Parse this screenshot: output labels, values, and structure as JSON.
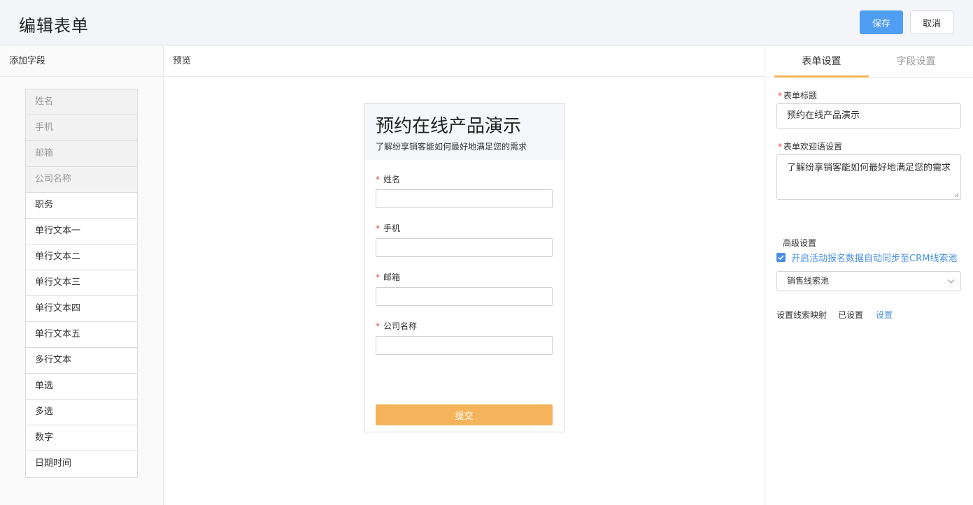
{
  "header": {
    "title": "编辑表单",
    "save_label": "保存",
    "cancel_label": "取消"
  },
  "left_panel": {
    "title": "添加字段",
    "used_fields": [
      "姓名",
      "手机",
      "邮箱",
      "公司名称"
    ],
    "fields": [
      "职务",
      "单行文本一",
      "单行文本二",
      "单行文本三",
      "单行文本四",
      "单行文本五",
      "多行文本",
      "单选",
      "多选",
      "数字",
      "日期时间"
    ]
  },
  "preview": {
    "title": "预览",
    "form_title": "预约在线产品演示",
    "form_subtitle": "了解纷享销客能如何最好地满足您的需求",
    "fields": [
      {
        "required_mark": "*",
        "label": "姓名"
      },
      {
        "required_mark": "*",
        "label": "手机"
      },
      {
        "required_mark": "*",
        "label": "邮箱"
      },
      {
        "required_mark": "*",
        "label": "公司名称"
      }
    ],
    "submit_label": "提交"
  },
  "settings": {
    "tabs": [
      "表单设置",
      "字段设置"
    ],
    "active_tab": "表单设置",
    "required_mark": "*",
    "form_title_label": "表单标题",
    "form_title_value": "预约在线产品演示",
    "welcome_label": "表单欢迎语设置",
    "welcome_value": "了解纷享销客能如何最好地满足您的需求",
    "advanced_label": "高级设置",
    "sync_checkbox_label": "开启活动报名数据自动同步至CRM线索池",
    "sync_checked": true,
    "pool_select_value": "销售线索池",
    "mapping_label": "设置线索映射",
    "mapping_status": "已设置",
    "mapping_link": "设置"
  },
  "colors": {
    "primary": "#4f9ef3",
    "accent_orange": "#f5b35b",
    "required_red": "#e64c3c",
    "link_blue": "#4a90e2"
  }
}
